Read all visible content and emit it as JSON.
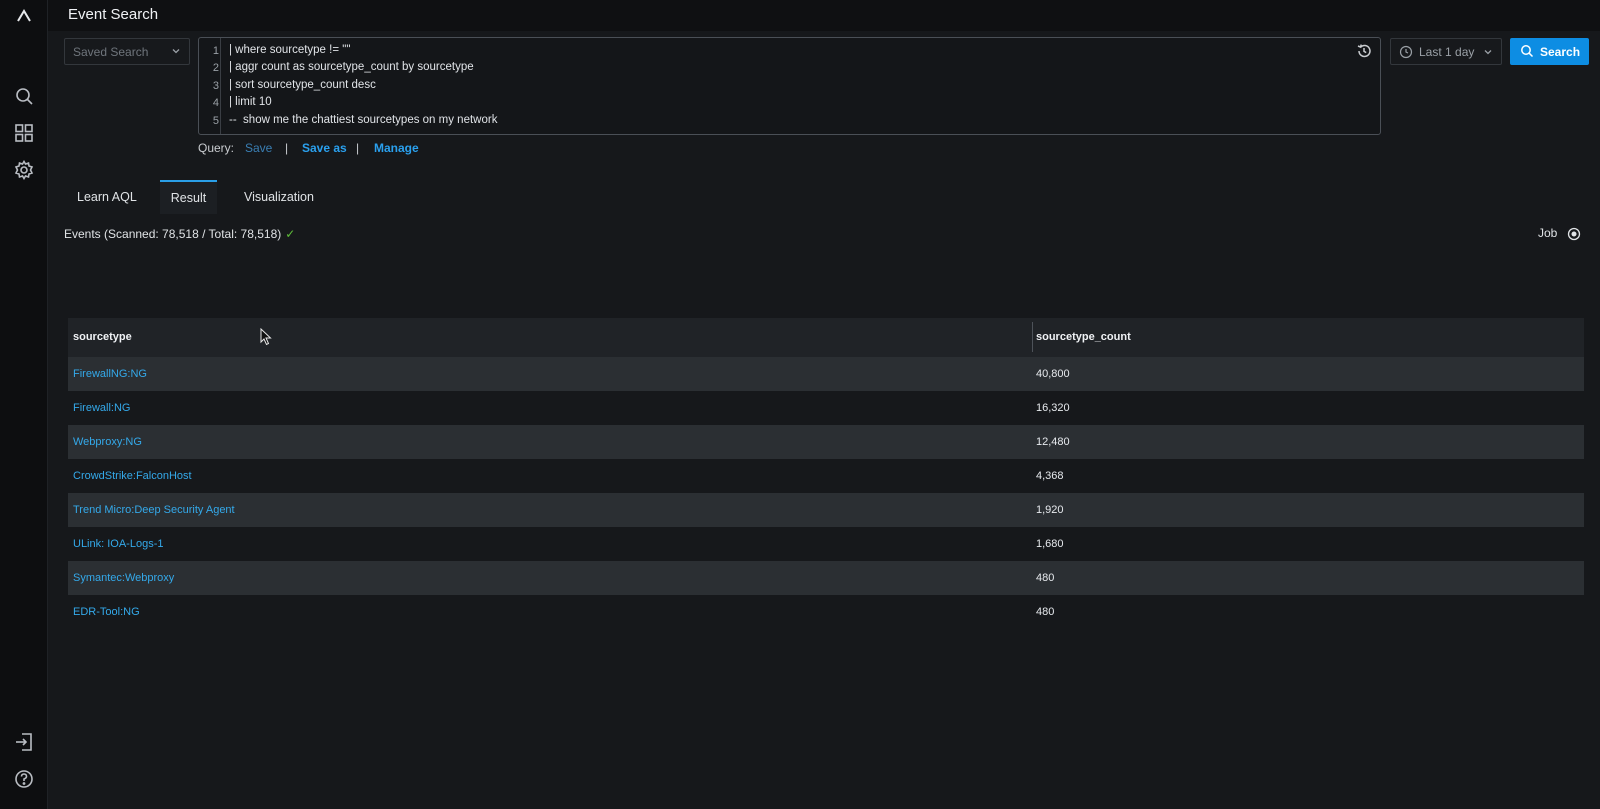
{
  "header": {
    "title": "Event Search"
  },
  "sidebar": {
    "items": [
      {
        "name": "logo-icon"
      },
      {
        "name": "search-icon"
      },
      {
        "name": "dashboard-icon"
      },
      {
        "name": "settings-icon"
      },
      {
        "name": "logout-icon"
      },
      {
        "name": "help-icon"
      }
    ]
  },
  "saved_search": {
    "placeholder": "Saved Search"
  },
  "editor": {
    "lines": [
      {
        "num": "1",
        "text": "| where sourcetype != \"\""
      },
      {
        "num": "2",
        "text": "| aggr count as sourcetype_count by sourcetype"
      },
      {
        "num": "3",
        "text": "| sort sourcetype_count desc"
      },
      {
        "num": "4",
        "text": "| limit 10"
      },
      {
        "num": "5",
        "text": "--  show me the chattiest sourcetypes on my network"
      }
    ]
  },
  "time_picker": {
    "label": "Last 1 day"
  },
  "search_button": {
    "label": "Search"
  },
  "query_bar": {
    "label": "Query:",
    "save": "Save",
    "sep": "|",
    "save_as": "Save as",
    "manage": "Manage"
  },
  "tabs": [
    {
      "label": "Learn AQL"
    },
    {
      "label": "Result",
      "active": true
    },
    {
      "label": "Visualization"
    }
  ],
  "events": {
    "text": "Events (Scanned: 78,518 / Total: 78,518)",
    "check": "✓"
  },
  "job": {
    "label": "Job"
  },
  "table": {
    "columns": [
      "sourcetype",
      "sourcetype_count"
    ],
    "rows": [
      {
        "sourcetype": "FirewallNG:NG",
        "count": "40,800"
      },
      {
        "sourcetype": "Firewall:NG",
        "count": "16,320"
      },
      {
        "sourcetype": "Webproxy:NG",
        "count": "12,480"
      },
      {
        "sourcetype": "CrowdStrike:FalconHost",
        "count": "4,368"
      },
      {
        "sourcetype": "Trend Micro:Deep Security Agent",
        "count": "1,920"
      },
      {
        "sourcetype": "ULink: IOA-Logs-1",
        "count": "1,680"
      },
      {
        "sourcetype": "Symantec:Webproxy",
        "count": "480"
      },
      {
        "sourcetype": "EDR-Tool:NG",
        "count": "480"
      }
    ]
  },
  "colors": {
    "accent": "#0d8de3",
    "link": "#34a9ea",
    "success": "#5fbf3a"
  }
}
